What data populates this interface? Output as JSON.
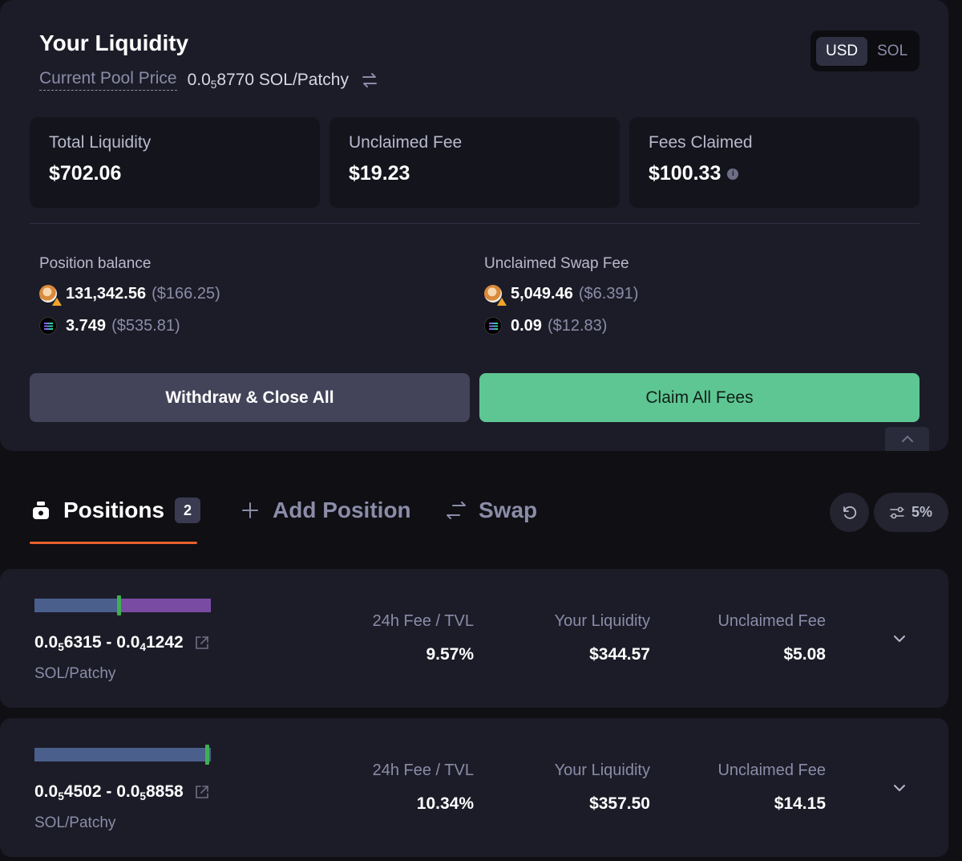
{
  "liquidity": {
    "title": "Your Liquidity",
    "price_label": "Current Pool Price",
    "price_prefix": "0.0",
    "price_zero_count": "5",
    "price_digits": "8770 SOL/Patchy",
    "currency_toggle": {
      "options": [
        "USD",
        "SOL"
      ],
      "selected": "USD"
    },
    "stats": [
      {
        "label": "Total Liquidity",
        "value": "$702.06"
      },
      {
        "label": "Unclaimed Fee",
        "value": "$19.23"
      },
      {
        "label": "Fees Claimed",
        "value": "$100.33"
      }
    ],
    "position_balance": {
      "label": "Position balance",
      "tokens": [
        {
          "icon": "patchy-token-icon",
          "amount": "131,342.56",
          "usd": "($166.25)"
        },
        {
          "icon": "sol-token-icon",
          "amount": "3.749",
          "usd": "($535.81)"
        }
      ]
    },
    "unclaimed_swap_fee": {
      "label": "Unclaimed Swap Fee",
      "tokens": [
        {
          "icon": "patchy-token-icon",
          "amount": "5,049.46",
          "usd": "($6.391)"
        },
        {
          "icon": "sol-token-icon",
          "amount": "0.09",
          "usd": "($12.83)"
        }
      ]
    },
    "buttons": {
      "withdraw": "Withdraw & Close All",
      "claim": "Claim All Fees"
    }
  },
  "tabs": {
    "positions": {
      "label": "Positions",
      "count": "2"
    },
    "add_position": {
      "label": "Add Position"
    },
    "swap": {
      "label": "Swap"
    },
    "slippage": "5%"
  },
  "colors": {
    "accent_orange": "#e8602c",
    "claim_green": "#5ec693",
    "range_blue": "#4a5f8c",
    "range_purple": "#7a4ba3",
    "marker_green": "#3fb052"
  },
  "positions": [
    {
      "range_low_prefix": "0.0",
      "range_low_zeros": "5",
      "range_low_digits": "6315",
      "range_high_prefix": "0.0",
      "range_high_zeros": "4",
      "range_high_digits": "1242",
      "pair": "SOL/Patchy",
      "fee_tvl_label": "24h Fee / TVL",
      "fee_tvl": "9.57%",
      "liquidity_label": "Your Liquidity",
      "liquidity": "$344.57",
      "unclaimed_label": "Unclaimed Fee",
      "unclaimed": "$5.08",
      "current_price_fraction": 0.48
    },
    {
      "range_low_prefix": "0.0",
      "range_low_zeros": "5",
      "range_low_digits": "4502",
      "range_high_prefix": "0.0",
      "range_high_zeros": "5",
      "range_high_digits": "8858",
      "pair": "SOL/Patchy",
      "fee_tvl_label": "24h Fee / TVL",
      "fee_tvl": "10.34%",
      "liquidity_label": "Your Liquidity",
      "liquidity": "$357.50",
      "unclaimed_label": "Unclaimed Fee",
      "unclaimed": "$14.15",
      "current_price_fraction": 0.98
    }
  ]
}
